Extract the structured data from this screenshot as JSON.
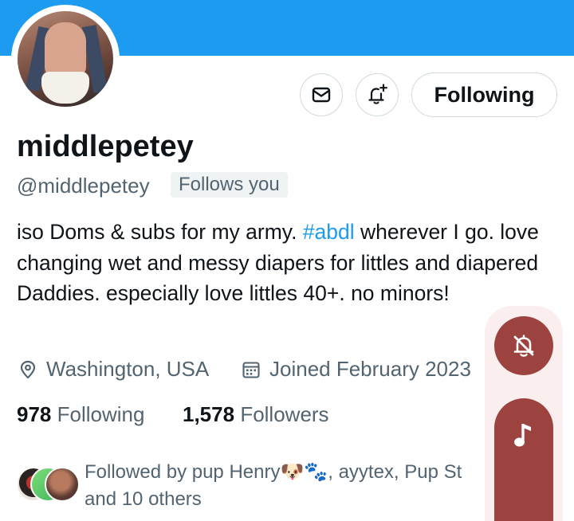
{
  "profile": {
    "display_name": "middlepetey",
    "handle": "@middlepetey",
    "follows_you_badge": "Follows you",
    "bio_prefix": "iso Doms & subs for my army. ",
    "bio_hashtag": "#abdl",
    "bio_rest": " wherever I go. love changing wet and messy diapers for littles and diapered Daddies. especially love littles 40+. no minors!",
    "location": "Washington, USA",
    "joined": "Joined February 2023",
    "following_count": "978",
    "following_label": "Following",
    "followers_count": "1,578",
    "followers_label": "Followers",
    "followed_by_text": "Followed by pup Henry🐶🐾, ayytex, Pup St",
    "followed_by_more": "and 10 others"
  },
  "actions": {
    "follow_button_label": "Following",
    "message_icon": "envelope-icon",
    "notify_icon": "bell-plus-icon"
  },
  "overlay": {
    "mute_icon": "bell-slash-icon",
    "music_icon": "music-note-icon"
  },
  "colors": {
    "banner": "#1d9bf0",
    "hashtag": "#1d9bf0",
    "overlay_button": "#9c433f"
  }
}
